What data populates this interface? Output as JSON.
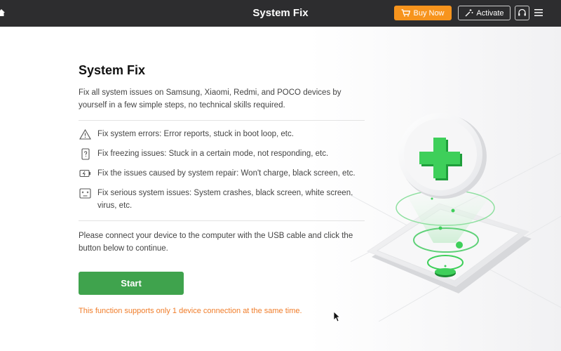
{
  "titlebar": {
    "title": "System Fix",
    "buy_now": "Buy Now",
    "activate": "Activate"
  },
  "main": {
    "title": "System Fix",
    "intro": "Fix all system issues on Samsung, Xiaomi, Redmi, and POCO devices by yourself in a few simple steps, no technical skills required.",
    "issues": [
      {
        "icon": "warning-triangle-icon",
        "text": "Fix system errors: Error reports, stuck in boot loop, etc."
      },
      {
        "icon": "phone-question-icon",
        "text": "Fix freezing issues: Stuck in a certain mode, not responding, etc."
      },
      {
        "icon": "battery-charge-icon",
        "text": "Fix the issues caused by system repair: Won't charge, black screen, etc."
      },
      {
        "icon": "screen-error-icon",
        "text": "Fix serious system issues: System crashes, black screen, white screen, virus, etc."
      }
    ],
    "connect_text": "Please connect your device to the computer with the USB cable and click the button below to continue.",
    "start_label": "Start",
    "notice": "This function supports only 1 device connection at the same time."
  },
  "colors": {
    "titlebar_bg": "#2d2d2f",
    "buy_now": "#f7941d",
    "start_button": "#3fa34d",
    "notice_text": "#f07d2a",
    "accent_green": "#3ecf5a"
  }
}
